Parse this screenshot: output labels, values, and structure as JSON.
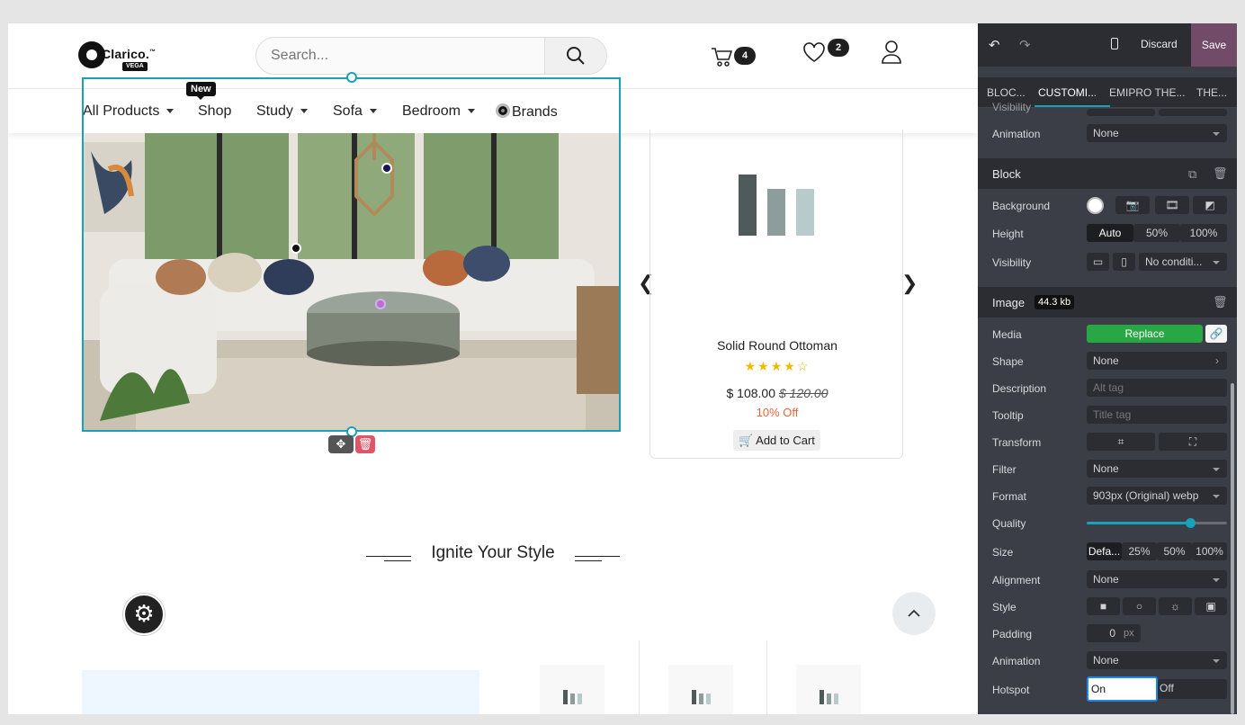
{
  "header": {
    "logo_text": "Clarico.",
    "logo_tm": "™",
    "logo_sub": "VEGA",
    "search_placeholder": "Search...",
    "cart_count": "4",
    "wishlist_count": "2"
  },
  "nav": {
    "new_tag": "New",
    "items": [
      "All Products",
      "Shop",
      "Study",
      "Sofa",
      "Bedroom",
      "Brands"
    ]
  },
  "product": {
    "name": "Solid Round Ottoman",
    "price": "$ 108.00",
    "old_price": "$ 120.00",
    "discount": "10% Off",
    "add_to_cart": "Add to Cart",
    "rating": 4,
    "rating_max": 5
  },
  "section": {
    "title": "Ignite Your Style"
  },
  "editor": {
    "discard": "Discard",
    "save": "Save",
    "tabs": [
      "BLOC...",
      "CUSTOMI...",
      "EMIPRO THE...",
      "THE..."
    ],
    "visibility_partial": "Visibility",
    "animation_label": "Animation",
    "animation_value": "None",
    "block_title": "Block",
    "background_label": "Background",
    "height_label": "Height",
    "height_options": [
      "Auto",
      "50%",
      "100%"
    ],
    "visibility_label": "Visibility",
    "visibility_value": "No conditi...",
    "image_title": "Image",
    "image_size": "44.3 kb",
    "media_label": "Media",
    "replace": "Replace",
    "shape_label": "Shape",
    "shape_value": "None",
    "description_label": "Description",
    "description_placeholder": "Alt tag",
    "tooltip_label": "Tooltip",
    "tooltip_placeholder": "Title tag",
    "transform_label": "Transform",
    "filter_label": "Filter",
    "filter_value": "None",
    "format_label": "Format",
    "format_value": "903px (Original) webp",
    "quality_label": "Quality",
    "quality_value": 0.74,
    "size_label": "Size",
    "size_options": [
      "Defa...",
      "25%",
      "50%",
      "100%"
    ],
    "alignment_label": "Alignment",
    "alignment_value": "None",
    "style_label": "Style",
    "padding_label": "Padding",
    "padding_value": "0",
    "padding_unit": "px",
    "animation2_label": "Animation",
    "animation2_value": "None",
    "hotspot_label": "Hotspot",
    "hotspot_on": "On",
    "hotspot_off": "Off"
  },
  "colors": {
    "accent": "#17a2b8",
    "save_bg": "#714b67",
    "replace_bg": "#28a745",
    "discount": "#e8643c",
    "star": "#f5b800"
  }
}
